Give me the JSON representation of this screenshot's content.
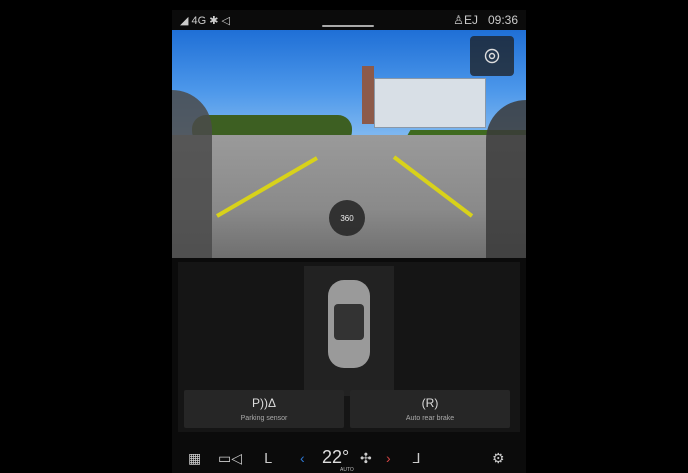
{
  "status_bar": {
    "signal": "4G",
    "user": "EJ",
    "time": "09:36"
  },
  "camera": {
    "mode_button_label": "360"
  },
  "features": [
    {
      "name": "Parking sensor",
      "icon": "parking-sensor-icon",
      "symbol": "P))Δ"
    },
    {
      "name": "Auto rear brake",
      "icon": "rear-brake-icon",
      "symbol": "(R)"
    }
  ],
  "climate": {
    "temperature": "22°",
    "mode": "AUTO"
  },
  "colors": {
    "accent_blue": "#2f7bd8",
    "accent_red": "#d64545",
    "background": "#000000"
  }
}
